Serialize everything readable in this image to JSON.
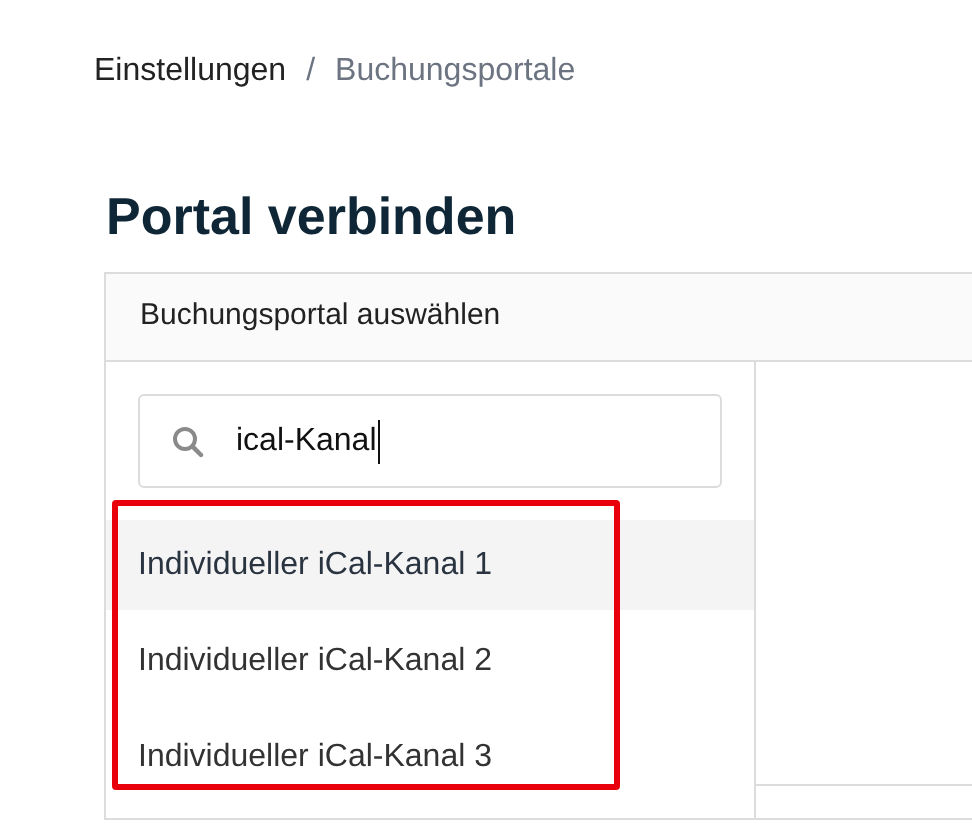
{
  "breadcrumb_separator": "/",
  "breadcrumb": [
    {
      "label": "Einstellungen",
      "current": false
    },
    {
      "label": "Buchungsportale",
      "current": true
    }
  ],
  "title": "Portal verbinden",
  "portal_select": {
    "label": "Buchungsportal auswählen",
    "search": {
      "value": "ical-Kanal"
    },
    "options": [
      {
        "label": "Individueller iCal-Kanal 1",
        "selected": true
      },
      {
        "label": "Individueller iCal-Kanal 2",
        "selected": false
      },
      {
        "label": "Individueller iCal-Kanal 3",
        "selected": false
      }
    ]
  }
}
